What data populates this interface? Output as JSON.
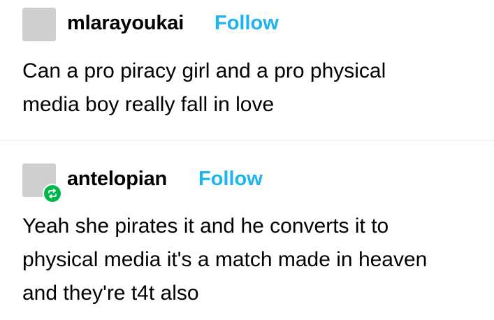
{
  "posts": [
    {
      "username": "mlarayoukai",
      "follow_label": "Follow",
      "body_lines": [
        "Can a pro piracy girl and a pro physical",
        "media boy really fall in love"
      ],
      "avatar_icon": "avatar-placeholder",
      "reblog": false
    },
    {
      "username": "antelopian",
      "follow_label": "Follow",
      "body_lines": [
        "Yeah she pirates it and he converts it to",
        "physical media it's a match made in heaven",
        "and they're t4t also"
      ],
      "avatar_icon": "avatar-placeholder",
      "reblog": true,
      "reblog_icon": "reblog-icon"
    }
  ],
  "colors": {
    "follow": "#1eb3f1",
    "avatar": "#cfcfcf",
    "reblog_badge": "#00b84a",
    "divider": "#e6e6e6",
    "text": "#000000"
  }
}
